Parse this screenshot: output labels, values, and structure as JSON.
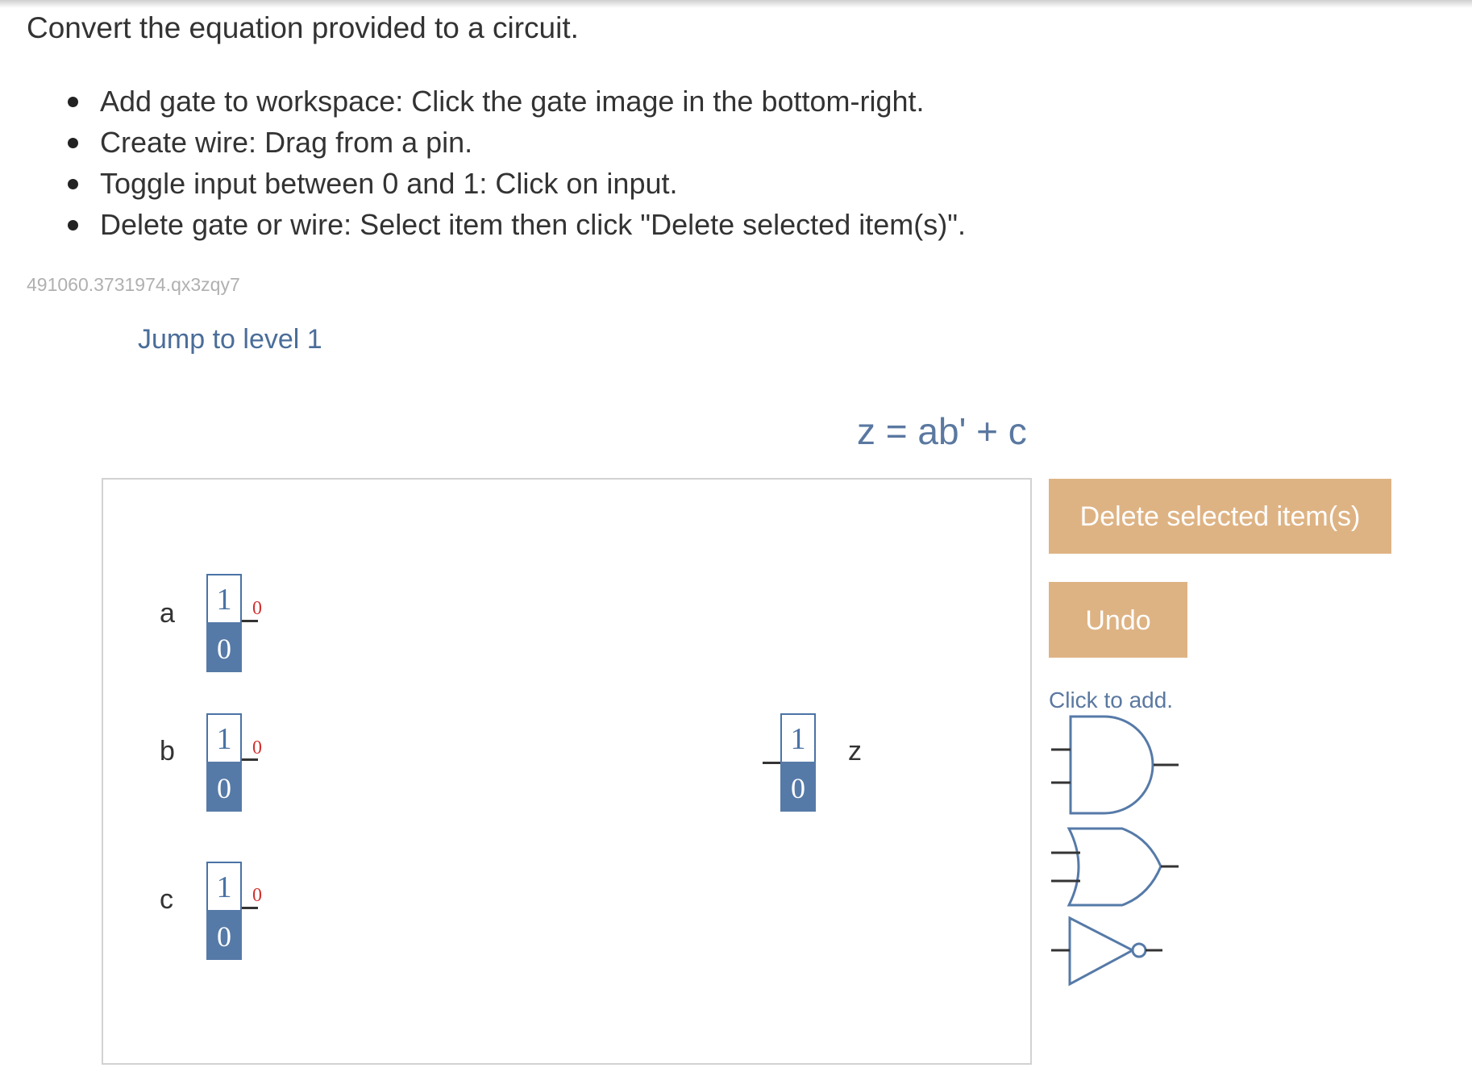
{
  "instructions": {
    "title": "Convert the equation provided to a circuit.",
    "items": [
      "Add gate to workspace: Click the gate image in the bottom-right.",
      "Create wire: Drag from a pin.",
      "Toggle input between 0 and 1: Click on input.",
      "Delete gate or wire: Select item then click \"Delete selected item(s)\"."
    ]
  },
  "activity_id": "491060.3731974.qx3zqy7",
  "jump_link": "Jump to level 1",
  "equation": "z = ab' + c",
  "inputs": [
    {
      "name": "a",
      "toggle_top": "1",
      "toggle_bottom": "0",
      "output_value": "0"
    },
    {
      "name": "b",
      "toggle_top": "1",
      "toggle_bottom": "0",
      "output_value": "0"
    },
    {
      "name": "c",
      "toggle_top": "1",
      "toggle_bottom": "0",
      "output_value": "0"
    }
  ],
  "output": {
    "name": "z",
    "top": "1",
    "bottom": "0"
  },
  "buttons": {
    "delete": "Delete selected item(s)",
    "undo": "Undo"
  },
  "palette": {
    "hint": "Click to add.",
    "gates": [
      "and-gate-icon",
      "or-gate-icon",
      "not-gate-icon"
    ]
  },
  "colors": {
    "accent_button": "#deb384",
    "io_blue": "#567aa8",
    "link_blue": "#4a6d99",
    "output_red": "#d0312d"
  }
}
